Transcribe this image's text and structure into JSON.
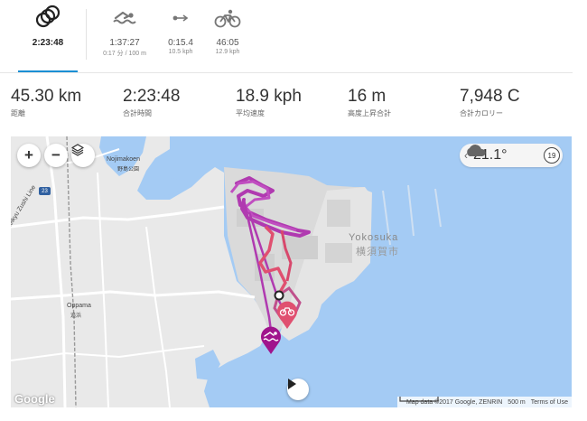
{
  "tabs": [
    {
      "label": "2:23:48",
      "sub": "",
      "icon": "multisport-rings-icon",
      "active": true
    },
    {
      "label": "1:37:27",
      "sub": "0:17 分 / 100 m",
      "icon": "swim-icon",
      "active": false
    },
    {
      "label": "0:15.4",
      "sub": "10.5 kph",
      "icon": "transition-icon",
      "active": false
    },
    {
      "label": "46:05",
      "sub": "12.9 kph",
      "icon": "bike-icon",
      "active": false
    }
  ],
  "stats": [
    {
      "value": "45.30 km",
      "label": "距離"
    },
    {
      "value": "2:23:48",
      "label": "合計時間"
    },
    {
      "value": "18.9 kph",
      "label": "平均速度"
    },
    {
      "value": "16 m",
      "label": "高度上昇合計"
    },
    {
      "value": "7,948 C",
      "label": "合計カロリー"
    }
  ],
  "map": {
    "zoom_in": "+",
    "zoom_out": "−",
    "weather": {
      "chevron": "‹",
      "temp": "21.1°",
      "badge": "19"
    },
    "places": {
      "nojimakoen": "Nojimakoen",
      "nojimakoen_jp": "野島公園",
      "oppama": "Oppama",
      "oppama_jp": "追浜",
      "yokosuka": "Yokosuka",
      "yokosuka_jp": "横須賀市",
      "line": "Keikyu Zushi Line",
      "road": "23"
    },
    "google": "Google",
    "attribution": "Map data ©2017 Google, ZENRIN",
    "scale": "500 m",
    "terms": "Terms of Use"
  },
  "colors": {
    "accent": "#1a8fd4",
    "swim": "#a0148c",
    "bike": "#e05070",
    "route": "#b03ab0",
    "water": "#a4cbf4"
  }
}
